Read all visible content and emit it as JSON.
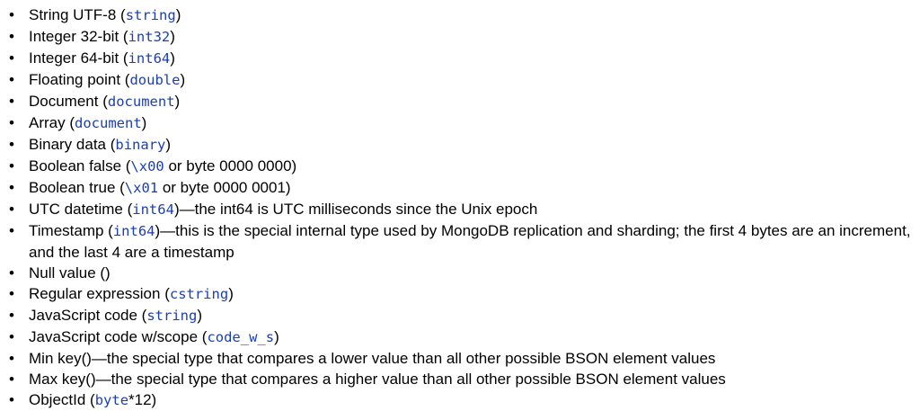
{
  "bullet_char": "•",
  "colors": {
    "text": "#000000",
    "code": "#1c3fb0",
    "background": "#ffffff"
  },
  "items": [
    {
      "label": "String UTF-8",
      "open": " (",
      "code": "string",
      "close": ")"
    },
    {
      "label": "Integer 32-bit",
      "open": " (",
      "code": "int32",
      "close": ")"
    },
    {
      "label": "Integer 64-bit",
      "open": " (",
      "code": "int64",
      "close": ")"
    },
    {
      "label": "Floating point",
      "open": " (",
      "code": "double",
      "close": ")"
    },
    {
      "label": "Document",
      "open": " (",
      "code": "document",
      "close": ")"
    },
    {
      "label": "Array",
      "open": " (",
      "code": "document",
      "close": ")"
    },
    {
      "label": "Binary data",
      "open": " (",
      "code": "binary",
      "close": ")"
    },
    {
      "label": "Boolean false",
      "open": " (",
      "code": "\\x00",
      "close": " or byte 0000 0000)"
    },
    {
      "label": "Boolean true",
      "open": " (",
      "code": "\\x01",
      "close": " or byte 0000 0001)"
    },
    {
      "label": "UTC datetime",
      "open": " (",
      "code": "int64",
      "close": ")—the int64 is UTC milliseconds since the Unix epoch"
    },
    {
      "label": "Timestamp",
      "open": " (",
      "code": "int64",
      "close": ")—this is the special internal type used by MongoDB replication and sharding; the first 4 bytes are an increment, and the last 4 are a timestamp",
      "wrap": true
    },
    {
      "label": "Null value ()",
      "open": "",
      "code": "",
      "close": ""
    },
    {
      "label": "Regular expression",
      "open": " (",
      "code": "cstring",
      "close": ")"
    },
    {
      "label": "JavaScript code",
      "open": " (",
      "code": "string",
      "close": ")"
    },
    {
      "label": "JavaScript code w/scope",
      "open": " (",
      "code": "code_w_s",
      "close": ")"
    },
    {
      "label": "Min key()—the special type that compares a lower value than all other possible BSON element values",
      "open": "",
      "code": "",
      "close": ""
    },
    {
      "label": "Max key()—the special type that compares a higher value than all other possible BSON element values",
      "open": "",
      "code": "",
      "close": ""
    },
    {
      "label": "ObjectId",
      "open": " (",
      "code": "byte",
      "close": "*12)"
    }
  ]
}
